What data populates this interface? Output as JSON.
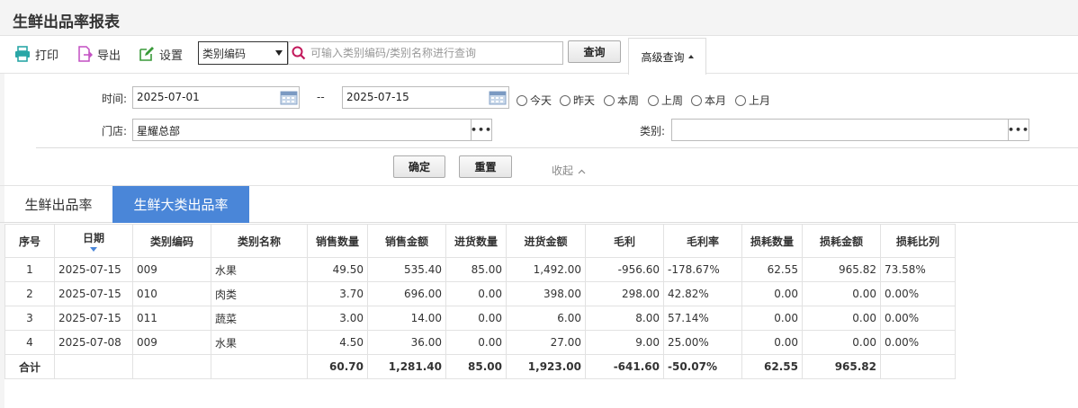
{
  "page": {
    "title": "生鲜出品率报表"
  },
  "toolbar": {
    "print_label": "打印",
    "export_label": "导出",
    "settings_label": "设置",
    "category_select": "类别编码",
    "search_placeholder": "可输入类别编码/类别名称进行查询",
    "query_label": "查询",
    "advanced_label": "高级查询"
  },
  "filter": {
    "time_label": "时间:",
    "start_date": "2025-07-01",
    "separator": "--",
    "end_date": "2025-07-15",
    "ranges": [
      "今天",
      "昨天",
      "本周",
      "上周",
      "本月",
      "上月"
    ],
    "store_label": "门店:",
    "store_value": "星耀总部",
    "category_label": "类别:",
    "category_value": "",
    "dots": "•••",
    "confirm_label": "确定",
    "reset_label": "重置",
    "collapse_label": "收起"
  },
  "tabs": [
    "生鲜出品率",
    "生鲜大类出品率"
  ],
  "table": {
    "headers": [
      "序号",
      "日期",
      "类别编码",
      "类别名称",
      "销售数量",
      "销售金额",
      "进货数量",
      "进货金额",
      "毛利",
      "毛利率",
      "损耗数量",
      "损耗金额",
      "损耗比列"
    ],
    "rows": [
      [
        "1",
        "2025-07-15",
        "009",
        "水果",
        "49.50",
        "535.40",
        "85.00",
        "1,492.00",
        "-956.60",
        "-178.67%",
        "62.55",
        "965.82",
        "73.58%"
      ],
      [
        "2",
        "2025-07-15",
        "010",
        "肉类",
        "3.70",
        "696.00",
        "0.00",
        "398.00",
        "298.00",
        "42.82%",
        "0.00",
        "0.00",
        "0.00%"
      ],
      [
        "3",
        "2025-07-15",
        "011",
        "蔬菜",
        "3.00",
        "14.00",
        "0.00",
        "6.00",
        "8.00",
        "57.14%",
        "0.00",
        "0.00",
        "0.00%"
      ],
      [
        "4",
        "2025-07-08",
        "009",
        "水果",
        "4.50",
        "36.00",
        "0.00",
        "27.00",
        "9.00",
        "25.00%",
        "0.00",
        "0.00",
        "0.00%"
      ]
    ],
    "total": [
      "合计",
      "",
      "",
      "",
      "60.70",
      "1,281.40",
      "85.00",
      "1,923.00",
      "-641.60",
      "-50.07%",
      "62.55",
      "965.82",
      ""
    ]
  },
  "colors": {
    "accent": "#4a86d8",
    "print_icon": "#2aa6a6",
    "export_icon": "#c24fc2",
    "settings_icon": "#3a9a3a",
    "search_icon": "#c2185b"
  }
}
